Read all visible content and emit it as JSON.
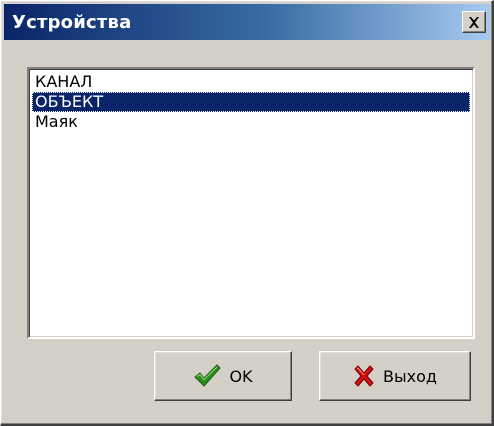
{
  "window": {
    "title": "Устройства"
  },
  "list": {
    "items": [
      {
        "label": "КАНАЛ",
        "selected": false
      },
      {
        "label": "ОБЪЕКТ",
        "selected": true
      },
      {
        "label": "Маяк",
        "selected": false
      }
    ]
  },
  "buttons": {
    "ok_label": "OK",
    "ok_icon": "checkmark-icon",
    "exit_label": "Выход",
    "exit_icon": "red-x-icon"
  },
  "colors": {
    "titlebar": "#0a246a",
    "selection": "#0a246a",
    "face": "#d4d0c8",
    "ok_check": "#2e8b20",
    "exit_x": "#d01010"
  }
}
